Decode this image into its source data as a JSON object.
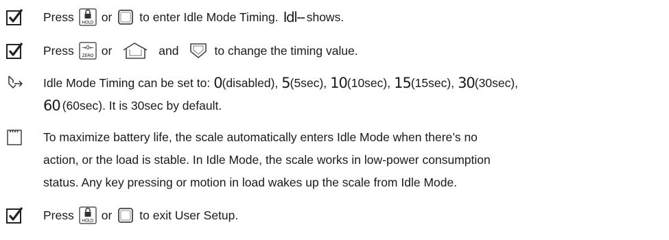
{
  "steps": [
    {
      "icon": "check-box-icon",
      "segments": {
        "press": "Press",
        "or": "or",
        "text_after": "to enter Idle Mode Timing.",
        "display": "Idl--",
        "shows": "shows."
      },
      "keys": [
        "hold-key",
        "blank-key"
      ]
    },
    {
      "icon": "check-box-icon",
      "segments": {
        "press": "Press",
        "or": "or",
        "and": "and",
        "text_after": "to change the timing value."
      },
      "keys": [
        "zero-key",
        "up-key",
        "down-key"
      ]
    },
    {
      "icon": "arrow-hint-icon",
      "line1": {
        "intro": "Idle Mode Timing can be set to:",
        "values": [
          {
            "digit": "0",
            "label": "(disabled),"
          },
          {
            "digit": "5",
            "label": "(5sec),"
          },
          {
            "digit": "10",
            "label": "(10sec),"
          },
          {
            "digit": "15",
            "label": "(15sec),"
          },
          {
            "digit": "30",
            "label": "(30sec),"
          }
        ]
      },
      "line2": {
        "digit": "60",
        "label": "(60sec). It is 30sec by default."
      }
    },
    {
      "icon": "note-icon",
      "lines": [
        "To maximize battery life, the scale automatically enters Idle Mode when there’s no",
        "action, or the load is stable. In Idle Mode, the scale works in low-power consumption",
        "status. Any key pressing or motion in load wakes up the scale from Idle Mode."
      ]
    },
    {
      "icon": "check-box-icon",
      "segments": {
        "press": "Press",
        "or": "or",
        "text_after": "to exit User Setup."
      },
      "keys": [
        "hold-key",
        "blank-key"
      ]
    }
  ],
  "key_labels": {
    "hold": "HOLD",
    "zero_top": "→0←",
    "zero_bottom": "ZERO"
  }
}
